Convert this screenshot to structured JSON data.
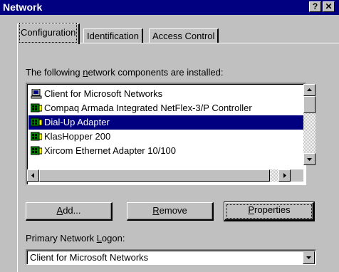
{
  "window": {
    "title": "Network",
    "help_button": "?",
    "close_button": "✕"
  },
  "tabs": [
    {
      "label": "Configuration",
      "active": true
    },
    {
      "label": "Identification",
      "active": false
    },
    {
      "label": "Access Control",
      "active": false
    }
  ],
  "components": {
    "label_pre": "The following ",
    "label_ul": "n",
    "label_post": "etwork components are installed:",
    "items": [
      {
        "label": "Client for Microsoft Networks",
        "icon": "client-icon",
        "selected": false
      },
      {
        "label": "Compaq Armada Integrated NetFlex-3/P Controller",
        "icon": "network-adapter-icon",
        "selected": false
      },
      {
        "label": "Dial-Up Adapter",
        "icon": "network-adapter-icon",
        "selected": true
      },
      {
        "label": "KlasHopper 200",
        "icon": "network-adapter-icon",
        "selected": false
      },
      {
        "label": "Xircom Ethernet Adapter 10/100",
        "icon": "network-adapter-icon",
        "selected": false
      }
    ]
  },
  "buttons": {
    "add_ul": "A",
    "add_rest": "dd...",
    "remove_ul": "R",
    "remove_rest": "emove",
    "properties_ul": "P",
    "properties_rest": "roperties"
  },
  "logon": {
    "label_pre": "Primary Network ",
    "label_ul": "L",
    "label_post": "ogon:",
    "value": "Client for Microsoft Networks"
  },
  "colors": {
    "title_bar": "#000080",
    "selection": "#000080",
    "face": "#c0c0c0"
  }
}
